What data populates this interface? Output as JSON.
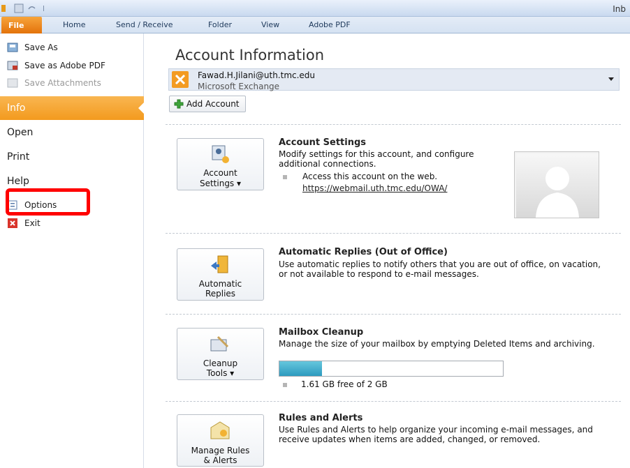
{
  "window": {
    "title_fragment": "Inb"
  },
  "ribbon": {
    "tabs": [
      "File",
      "Home",
      "Send / Receive",
      "Folder",
      "View",
      "Adobe PDF"
    ]
  },
  "nav": {
    "small_items": [
      {
        "label": "Save As",
        "icon": "save-as-icon"
      },
      {
        "label": "Save as Adobe PDF",
        "icon": "save-pdf-icon"
      },
      {
        "label": "Save Attachments",
        "icon": "save-attachments-icon",
        "disabled": true
      }
    ],
    "info": "Info",
    "open": "Open",
    "print": "Print",
    "help": "Help",
    "options": "Options",
    "exit": "Exit"
  },
  "content": {
    "title": "Account Information",
    "account": {
      "email": "Fawad.H.Jilani@uth.tmc.edu",
      "type": "Microsoft Exchange"
    },
    "add_account": "Add Account",
    "sections": {
      "settings": {
        "button_line1": "Account",
        "button_line2": "Settings ▾",
        "title": "Account Settings",
        "desc": "Modify settings for this account, and configure additional connections.",
        "bullet": "Access this account on the web.",
        "link": "https://webmail.uth.tmc.edu/OWA/"
      },
      "auto": {
        "button_line1": "Automatic",
        "button_line2": "Replies",
        "title": "Automatic Replies (Out of Office)",
        "desc": "Use automatic replies to notify others that you are out of office, on vacation, or not available to respond to e-mail messages."
      },
      "cleanup": {
        "button_line1": "Cleanup",
        "button_line2": "Tools ▾",
        "title": "Mailbox Cleanup",
        "desc": "Manage the size of your mailbox by emptying Deleted Items and archiving.",
        "usage_fraction": 0.19,
        "storage": "1.61 GB free of 2 GB"
      },
      "rules": {
        "button_line1": "Manage Rules",
        "button_line2": "& Alerts",
        "title": "Rules and Alerts",
        "desc": "Use Rules and Alerts to help organize your incoming e-mail messages, and receive updates when items are added, changed, or removed."
      }
    }
  }
}
